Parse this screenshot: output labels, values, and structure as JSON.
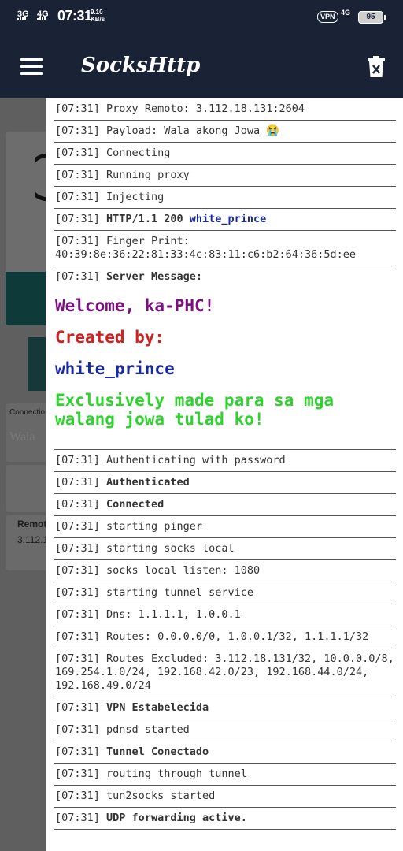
{
  "status_bar": {
    "sig1": "3G",
    "sig2": "4G",
    "time": "07:31",
    "speed_value": "9.10",
    "speed_unit": "KB/s",
    "vpn": "VPN",
    "network": "4G",
    "battery": "95"
  },
  "toolbar": {
    "title": "SocksHttp",
    "menu_icon": "hamburger-menu-icon",
    "delete_icon": "trash-icon"
  },
  "background": {
    "connection_label": "Connectio",
    "payload_preview": "Wala",
    "remote_label": "Remot",
    "remote_value": "3.112.1"
  },
  "logs": {
    "lines": [
      {
        "time": "[07:31]",
        "text": "Proxy Remoto: 3.112.18.131:2604"
      },
      {
        "time": "[07:31]",
        "text": "Payload: Wala akong Jowa 😭"
      },
      {
        "time": "[07:31]",
        "text": "Connecting"
      },
      {
        "time": "[07:31]",
        "text": "Running proxy"
      },
      {
        "time": "[07:31]",
        "text": "Injecting"
      },
      {
        "time": "[07:31]",
        "text_bold": "HTTP/1.1 200",
        "text_blue": "white_prince"
      },
      {
        "time": "[07:31]",
        "text": "Finger Print: 40:39:8e:36:22:81:33:4c:83:11:c6:b2:64:36:5d:ee"
      }
    ],
    "server_message": {
      "time": "[07:31]",
      "label": "Server Message:",
      "welcome": "Welcome, ka-PHC!",
      "created_by": "Created by:",
      "author": "white_prince",
      "note": "Exclusively made para sa mga walang jowa tulad ko!"
    },
    "lines_after": [
      {
        "time": "[07:31]",
        "text": "Authenticating with password",
        "bold": false
      },
      {
        "time": "[07:31]",
        "text": "Authenticated",
        "bold": true
      },
      {
        "time": "[07:31]",
        "text": "Connected",
        "bold": true
      },
      {
        "time": "[07:31]",
        "text": "starting pinger",
        "bold": false
      },
      {
        "time": "[07:31]",
        "text": "starting socks local",
        "bold": false
      },
      {
        "time": "[07:31]",
        "text": "socks local listen: 1080",
        "bold": false
      },
      {
        "time": "[07:31]",
        "text": "starting tunnel service",
        "bold": false
      },
      {
        "time": "[07:31]",
        "text": "Dns: 1.1.1.1, 1.0.0.1",
        "bold": false
      },
      {
        "time": "[07:31]",
        "text": "Routes: 0.0.0.0/0, 1.0.0.1/32, 1.1.1.1/32",
        "bold": false
      },
      {
        "time": "[07:31]",
        "text": "Routes Excluded: 3.112.18.131/32, 10.0.0.0/8, 169.254.1.0/24, 192.168.42.0/23, 192.168.44.0/24, 192.168.49.0/24",
        "bold": false
      },
      {
        "time": "[07:31]",
        "text": "VPN Estabelecida",
        "bold": true
      },
      {
        "time": "[07:31]",
        "text": "pdnsd started",
        "bold": false
      },
      {
        "time": "[07:31]",
        "text": "Tunnel Conectado",
        "bold": true
      },
      {
        "time": "[07:31]",
        "text": "routing through tunnel",
        "bold": false
      },
      {
        "time": "[07:31]",
        "text": "tun2socks started",
        "bold": false
      },
      {
        "time": "[07:31]",
        "text": "UDP forwarding active.",
        "bold": true
      }
    ]
  }
}
